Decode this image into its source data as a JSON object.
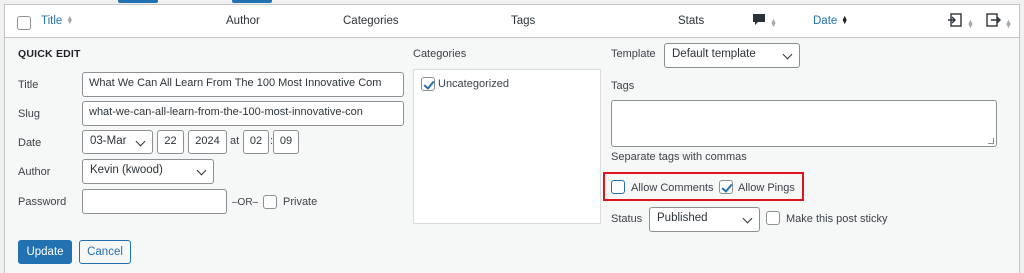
{
  "header": {
    "title": "Title",
    "author": "Author",
    "categories": "Categories",
    "tags": "Tags",
    "stats": "Stats",
    "date": "Date"
  },
  "quick_edit": {
    "heading": "QUICK EDIT",
    "title_label": "Title",
    "title_value": "What We Can All Learn From The 100 Most Innovative Com",
    "slug_label": "Slug",
    "slug_value": "what-we-can-all-learn-from-the-100-most-innovative-con",
    "date_label": "Date",
    "date_month": "03-Mar",
    "date_day": "22",
    "date_year": "2024",
    "date_at": "at",
    "date_hour": "02",
    "date_colon": ":",
    "date_minute": "09",
    "author_label": "Author",
    "author_value": "Kevin (kwood)",
    "password_label": "Password",
    "password_value": "",
    "or_text": "–OR–",
    "private_label": "Private",
    "categories_heading": "Categories",
    "category_item": "Uncategorized",
    "template_label": "Template",
    "template_value": "Default template",
    "tags_label": "Tags",
    "tags_help": "Separate tags with commas",
    "allow_comments": "Allow Comments",
    "allow_pings": "Allow Pings",
    "status_label": "Status",
    "status_value": "Published",
    "sticky_label": "Make this post sticky",
    "update_button": "Update",
    "cancel_button": "Cancel"
  },
  "colors": {
    "accent": "#2271b1",
    "highlight": "#e0151b"
  }
}
